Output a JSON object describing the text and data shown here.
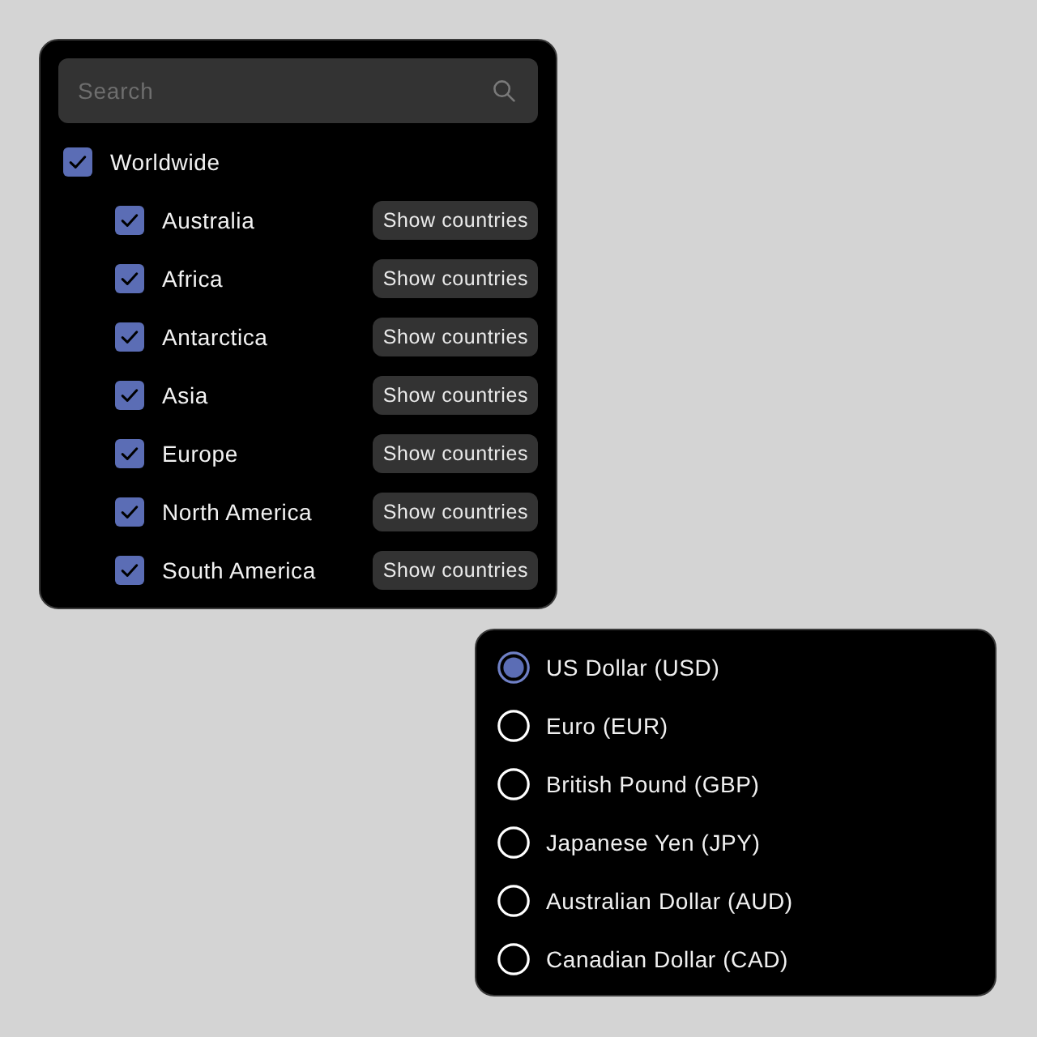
{
  "filter_panel": {
    "search": {
      "placeholder": "Search"
    },
    "tree": [
      {
        "label": "Worldwide",
        "checked": true,
        "children": [
          {
            "label": "Australia",
            "checked": true,
            "action": "Show countries"
          },
          {
            "label": "Africa",
            "checked": true,
            "action": "Show countries"
          },
          {
            "label": "Antarctica",
            "checked": true,
            "action": "Show countries"
          },
          {
            "label": "Asia",
            "checked": true,
            "action": "Show countries"
          },
          {
            "label": "Europe",
            "checked": true,
            "action": "Show countries"
          },
          {
            "label": "North America",
            "checked": true,
            "action": "Show countries"
          },
          {
            "label": "South America",
            "checked": true,
            "action": "Show countries"
          }
        ]
      }
    ]
  },
  "currency_panel": {
    "options": [
      {
        "label": "US Dollar (USD)",
        "selected": true
      },
      {
        "label": "Euro (EUR)",
        "selected": false
      },
      {
        "label": "British Pound (GBP)",
        "selected": false
      },
      {
        "label": "Japanese Yen (JPY)",
        "selected": false
      },
      {
        "label": "Australian Dollar (AUD)",
        "selected": false
      },
      {
        "label": "Canadian Dollar (CAD)",
        "selected": false
      }
    ]
  }
}
